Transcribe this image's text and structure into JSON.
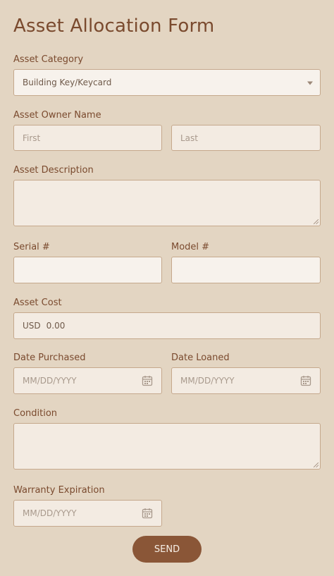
{
  "form": {
    "title": "Asset Allocation Form",
    "asset_category": {
      "label": "Asset Category",
      "value": "Building Key/Keycard"
    },
    "owner_name": {
      "label": "Asset Owner Name",
      "first_placeholder": "First",
      "last_placeholder": "Last"
    },
    "description": {
      "label": "Asset Description"
    },
    "serial": {
      "label": "Serial #"
    },
    "model": {
      "label": "Model #"
    },
    "cost": {
      "label": "Asset Cost",
      "currency": "USD",
      "value": "0.00"
    },
    "date_purchased": {
      "label": "Date Purchased",
      "placeholder": "MM/DD/YYYY"
    },
    "date_loaned": {
      "label": "Date Loaned",
      "placeholder": "MM/DD/YYYY"
    },
    "condition": {
      "label": "Condition"
    },
    "warranty": {
      "label": "Warranty Expiration",
      "placeholder": "MM/DD/YYYY"
    },
    "send_label": "SEND"
  },
  "colors": {
    "background": "#e3d5c2",
    "accent": "#8a5637",
    "text": "#7a4a2e"
  },
  "icons": [
    "chevron-down-icon",
    "calendar-icon",
    "resize-grip-icon"
  ]
}
